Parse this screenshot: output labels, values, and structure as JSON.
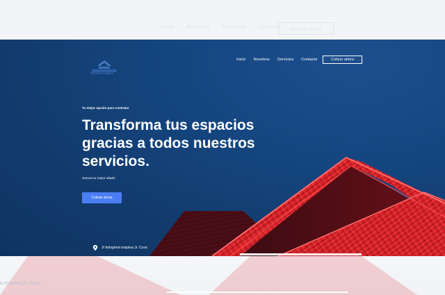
{
  "ghost_header": {
    "nav": [
      "Inicio",
      "Nosotros",
      "Servicios",
      "Contacto"
    ],
    "cta": "Cotizar ahora"
  },
  "brand": {
    "logo_text": "ESTRUCTURAS",
    "accent": "#4b82c8"
  },
  "nav": {
    "items": [
      "Inicio",
      "Nosotros",
      "Servicios",
      "Contacto"
    ],
    "cta": "Cotizar ahora"
  },
  "hero": {
    "eyebrow": "Tu mejor opción para contratar",
    "headline": "Transforma tus espacios gracias a todos nuestros servicios.",
    "subtext": "Somos tu mejor aliado",
    "cta": "Cotizar ahora",
    "address": "Jr bolognesi esquina Jr. Cuva",
    "background_color": "#154680",
    "roof_color": "#e0202a",
    "button_color": "#4b7df2"
  },
  "lower": {
    "ghost_address": "a esquina Jr. Cuva"
  }
}
